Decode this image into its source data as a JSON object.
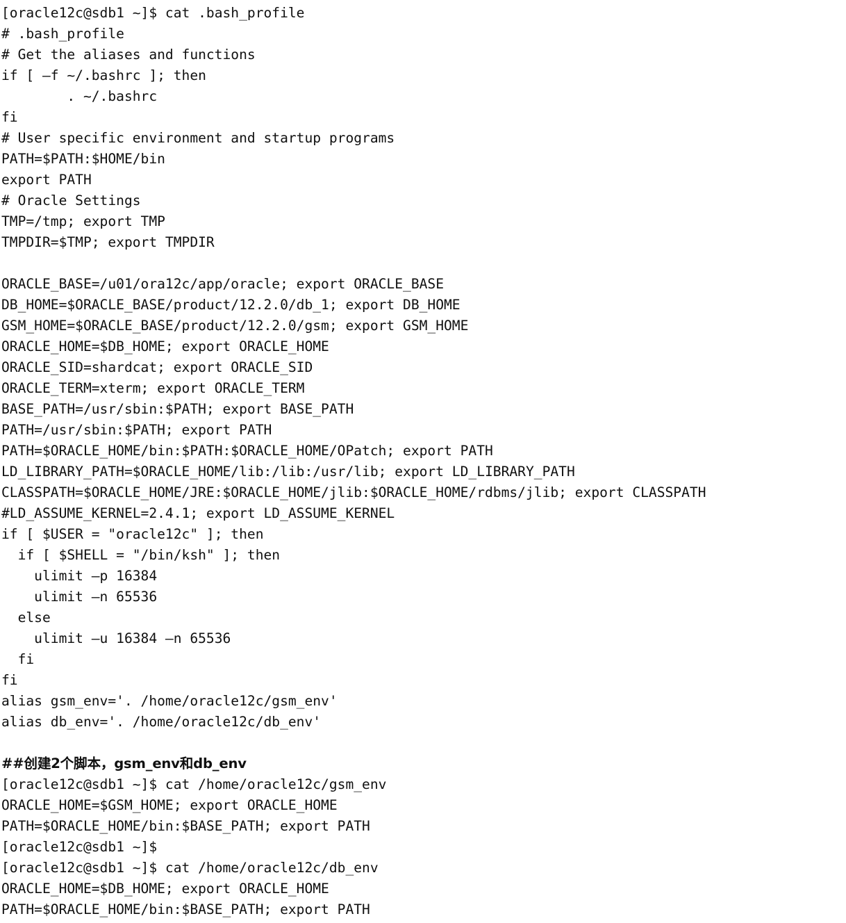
{
  "app": {
    "type": "terminal-session",
    "shell_user": "oracle12c",
    "shell_host": "sdb1",
    "prompt": "[oracle12c@sdb1 ~]$",
    "background_color": "#ffffff",
    "text_color": "#101010"
  },
  "terminal": {
    "lines": [
      "[oracle12c@sdb1 ~]$ cat .bash_profile",
      "# .bash_profile",
      "# Get the aliases and functions",
      "if [ –f ~/.bashrc ]; then",
      "        . ~/.bashrc",
      "fi",
      "# User specific environment and startup programs",
      "PATH=$PATH:$HOME/bin",
      "export PATH",
      "# Oracle Settings",
      "TMP=/tmp; export TMP",
      "TMPDIR=$TMP; export TMPDIR",
      "",
      "ORACLE_BASE=/u01/ora12c/app/oracle; export ORACLE_BASE",
      "DB_HOME=$ORACLE_BASE/product/12.2.0/db_1; export DB_HOME",
      "GSM_HOME=$ORACLE_BASE/product/12.2.0/gsm; export GSM_HOME",
      "ORACLE_HOME=$DB_HOME; export ORACLE_HOME",
      "ORACLE_SID=shardcat; export ORACLE_SID",
      "ORACLE_TERM=xterm; export ORACLE_TERM",
      "BASE_PATH=/usr/sbin:$PATH; export BASE_PATH",
      "PATH=/usr/sbin:$PATH; export PATH",
      "PATH=$ORACLE_HOME/bin:$PATH:$ORACLE_HOME/OPatch; export PATH",
      "LD_LIBRARY_PATH=$ORACLE_HOME/lib:/lib:/usr/lib; export LD_LIBRARY_PATH",
      "CLASSPATH=$ORACLE_HOME/JRE:$ORACLE_HOME/jlib:$ORACLE_HOME/rdbms/jlib; export CLASSPATH",
      "#LD_ASSUME_KERNEL=2.4.1; export LD_ASSUME_KERNEL",
      "if [ $USER = \"oracle12c\" ]; then",
      "  if [ $SHELL = \"/bin/ksh\" ]; then",
      "    ulimit –p 16384",
      "    ulimit –n 65536",
      "  else",
      "    ulimit –u 16384 –n 65536",
      "  fi",
      "fi",
      "alias gsm_env='. /home/oracle12c/gsm_env'",
      "alias db_env='. /home/oracle12c/db_env'",
      "",
      "##创建2个脚本，gsm_env和db_env",
      "[oracle12c@sdb1 ~]$ cat /home/oracle12c/gsm_env",
      "ORACLE_HOME=$GSM_HOME; export ORACLE_HOME",
      "PATH=$ORACLE_HOME/bin:$BASE_PATH; export PATH",
      "[oracle12c@sdb1 ~]$",
      "[oracle12c@sdb1 ~]$ cat /home/oracle12c/db_env",
      "ORACLE_HOME=$DB_HOME; export ORACLE_HOME",
      "PATH=$ORACLE_HOME/bin:$BASE_PATH; export PATH"
    ],
    "cjk_line_indices": [
      36
    ],
    "blank_line_indices": [
      12,
      35
    ]
  }
}
